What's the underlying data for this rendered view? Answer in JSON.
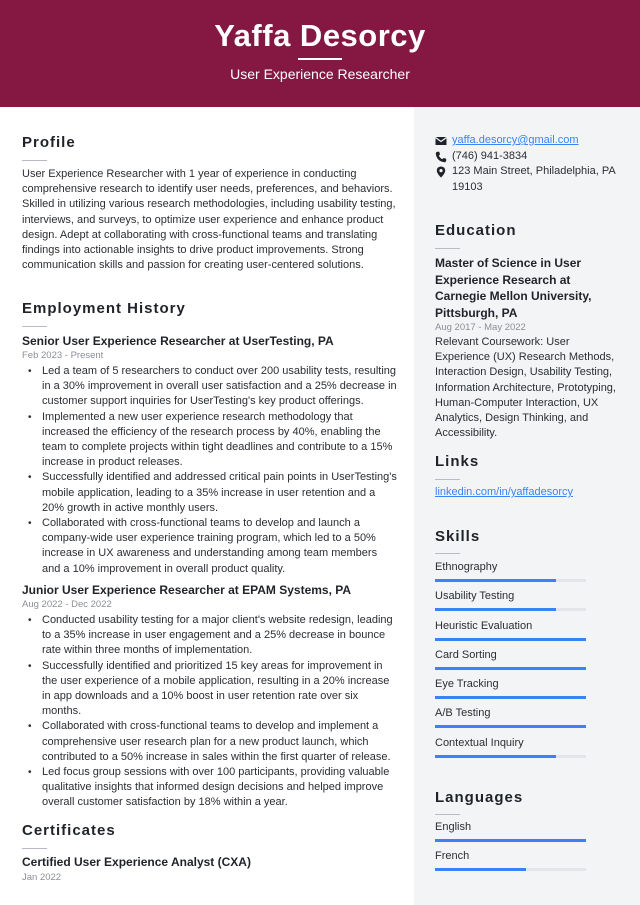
{
  "header": {
    "name": "Yaffa Desorcy",
    "title": "User Experience Researcher",
    "accent_color": "#841842"
  },
  "profile": {
    "heading": "Profile",
    "text": "User Experience Researcher with 1 year of experience in conducting comprehensive research to identify user needs, preferences, and behaviors. Skilled in utilizing various research methodologies, including usability testing, interviews, and surveys, to optimize user experience and enhance product design. Adept at collaborating with cross-functional teams and translating findings into actionable insights to drive product improvements. Strong communication skills and passion for creating user-centered solutions."
  },
  "employment": {
    "heading": "Employment History",
    "jobs": [
      {
        "title": "Senior User Experience Researcher at UserTesting, PA",
        "dates": "Feb 2023 - Present",
        "bullets": [
          "Led a team of 5 researchers to conduct over 200 usability tests, resulting in a 30% improvement in overall user satisfaction and a 25% decrease in customer support inquiries for UserTesting's key product offerings.",
          "Implemented a new user experience research methodology that increased the efficiency of the research process by 40%, enabling the team to complete projects within tight deadlines and contribute to a 15% increase in product releases.",
          "Successfully identified and addressed critical pain points in UserTesting's mobile application, leading to a 35% increase in user retention and a 20% growth in active monthly users.",
          "Collaborated with cross-functional teams to develop and launch a company-wide user experience training program, which led to a 50% increase in UX awareness and understanding among team members and a 10% improvement in overall product quality."
        ]
      },
      {
        "title": "Junior User Experience Researcher at EPAM Systems, PA",
        "dates": "Aug 2022 - Dec 2022",
        "bullets": [
          "Conducted usability testing for a major client's website redesign, leading to a 35% increase in user engagement and a 25% decrease in bounce rate within three months of implementation.",
          "Successfully identified and prioritized 15 key areas for improvement in the user experience of a mobile application, resulting in a 20% increase in app downloads and a 10% boost in user retention rate over six months.",
          "Collaborated with cross-functional teams to develop and implement a comprehensive user research plan for a new product launch, which contributed to a 50% increase in sales within the first quarter of release.",
          "Led focus group sessions with over 100 participants, providing valuable qualitative insights that informed design decisions and helped improve overall customer satisfaction by 18% within a year."
        ]
      }
    ]
  },
  "certificates": {
    "heading": "Certificates",
    "items": [
      {
        "title": "Certified User Experience Analyst (CXA)",
        "date": "Jan 2022"
      }
    ]
  },
  "contact": {
    "email": "yaffa.desorcy@gmail.com",
    "phone": "(746) 941-3834",
    "address": "123 Main Street, Philadelphia, PA 19103",
    "email_icon": "envelope-icon",
    "phone_icon": "phone-icon",
    "address_icon": "map-marker-icon"
  },
  "education": {
    "heading": "Education",
    "items": [
      {
        "title": "Master of Science in User Experience Research at Carnegie Mellon University, Pittsburgh, PA",
        "dates": "Aug 2017 - May 2022",
        "description": "Relevant Coursework: User Experience (UX) Research Methods, Interaction Design, Usability Testing, Information Architecture, Prototyping, Human-Computer Interaction, UX Analytics, Design Thinking, and Accessibility."
      }
    ]
  },
  "links": {
    "heading": "Links",
    "items": [
      {
        "label": "linkedin.com/in/yaffadesorcy"
      }
    ]
  },
  "skills": {
    "heading": "Skills",
    "bar_color": "#3b82f6",
    "items": [
      {
        "label": "Ethnography",
        "level": 0.8
      },
      {
        "label": "Usability Testing",
        "level": 0.8
      },
      {
        "label": "Heuristic Evaluation",
        "level": 1.0
      },
      {
        "label": "Card Sorting",
        "level": 1.0
      },
      {
        "label": "Eye Tracking",
        "level": 1.0
      },
      {
        "label": "A/B Testing",
        "level": 1.0
      },
      {
        "label": "Contextual Inquiry",
        "level": 0.8
      }
    ]
  },
  "languages": {
    "heading": "Languages",
    "items": [
      {
        "label": "English",
        "level": 1.0
      },
      {
        "label": "French",
        "level": 0.6
      }
    ]
  }
}
